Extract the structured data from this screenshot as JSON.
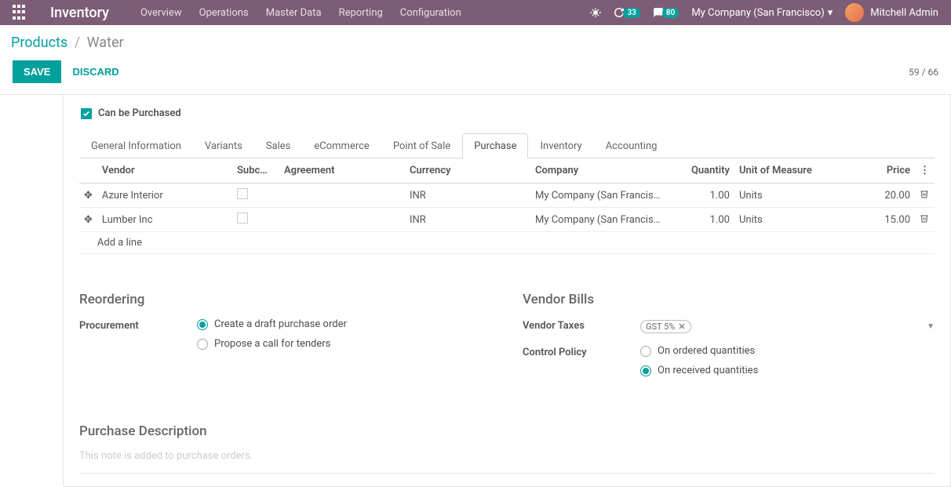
{
  "nav": {
    "app_title": "Inventory",
    "menu": [
      "Overview",
      "Operations",
      "Master Data",
      "Reporting",
      "Configuration"
    ],
    "refresh_badge": "33",
    "chat_badge": "80",
    "company": "My Company (San Francisco)",
    "user": "Mitchell Admin"
  },
  "breadcrumb": {
    "parent": "Products",
    "current": "Water"
  },
  "actions": {
    "save": "Save",
    "discard": "Discard",
    "pager": "59 / 66"
  },
  "purchase_check": {
    "label": "Can be Purchased"
  },
  "tabs": [
    "General Information",
    "Variants",
    "Sales",
    "eCommerce",
    "Point of Sale",
    "Purchase",
    "Inventory",
    "Accounting"
  ],
  "active_tab": 5,
  "vendor_table": {
    "headers": {
      "vendor": "Vendor",
      "subc": "Subc…",
      "agreement": "Agreement",
      "currency": "Currency",
      "company": "Company",
      "quantity": "Quantity",
      "uom": "Unit of Measure",
      "price": "Price"
    },
    "rows": [
      {
        "vendor": "Azure Interior",
        "currency": "INR",
        "company": "My Company (San Francis…",
        "qty": "1.00",
        "uom": "Units",
        "price": "20.00"
      },
      {
        "vendor": "Lumber Inc",
        "currency": "INR",
        "company": "My Company (San Francis…",
        "qty": "1.00",
        "uom": "Units",
        "price": "15.00"
      }
    ],
    "add_line": "Add a line"
  },
  "reordering": {
    "title": "Reordering",
    "procurement_label": "Procurement",
    "opt_draft": "Create a draft purchase order",
    "opt_tender": "Propose a call for tenders"
  },
  "vendor_bills": {
    "title": "Vendor Bills",
    "taxes_label": "Vendor Taxes",
    "tax_pill": "GST 5%",
    "control_label": "Control Policy",
    "opt_ordered": "On ordered quantities",
    "opt_received": "On received quantities"
  },
  "description": {
    "title": "Purchase Description",
    "placeholder": "This note is added to purchase orders."
  }
}
